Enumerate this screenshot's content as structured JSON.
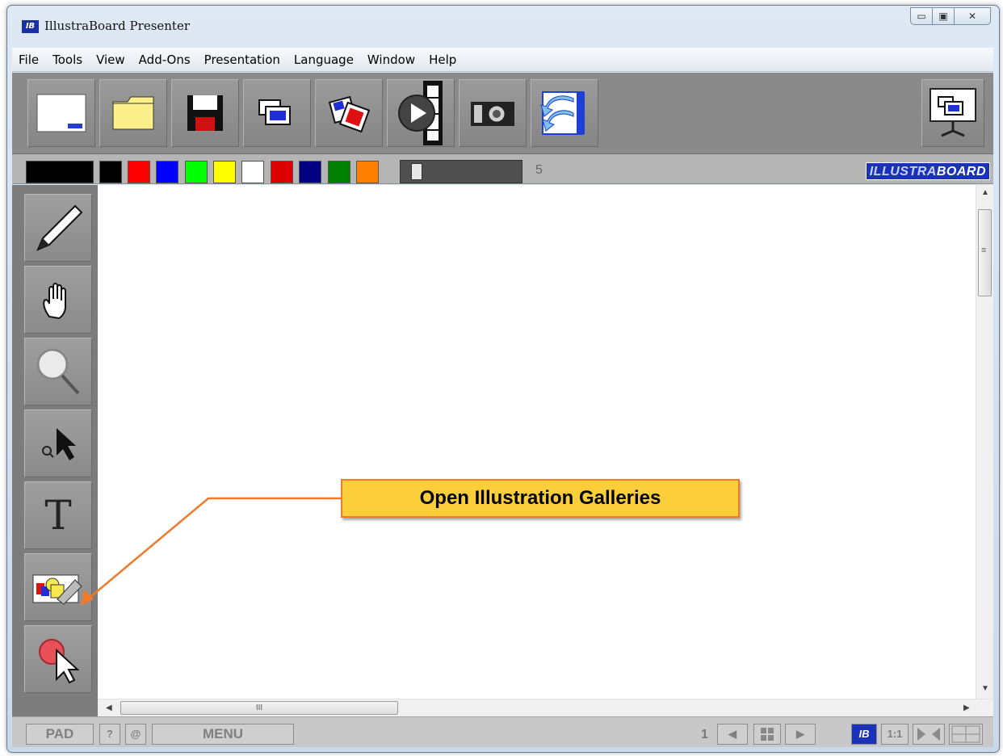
{
  "window": {
    "title": "IllustraBoard Presenter",
    "app_icon_text": "IB",
    "controls": {
      "minimize": "▭",
      "maximize": "▣",
      "close": "✕"
    }
  },
  "menu": {
    "items": [
      "File",
      "Tools",
      "View",
      "Add-Ons",
      "Presentation",
      "Language",
      "Window",
      "Help"
    ]
  },
  "toolbar": {
    "buttons": [
      {
        "name": "new-board-icon"
      },
      {
        "name": "open-folder-icon"
      },
      {
        "name": "save-disk-icon"
      },
      {
        "name": "slides-icon"
      },
      {
        "name": "pictures-icon"
      },
      {
        "name": "video-play-icon"
      },
      {
        "name": "camera-icon"
      },
      {
        "name": "undo-board-icon"
      }
    ],
    "presentation_monitor_icon": "presentation-monitor-icon"
  },
  "colorbar": {
    "current_color": "#000000",
    "swatches": [
      "#000000",
      "#ff0000",
      "#0000ff",
      "#00ff00",
      "#ffff00",
      "#ffffff",
      "#dd0000",
      "#000080",
      "#008000",
      "#ff8000"
    ],
    "thickness_value": "5",
    "logo": {
      "part1": "ILLUSTRA",
      "part2": "BOARD"
    }
  },
  "sidebar": {
    "tools": [
      {
        "name": "pen-tool-icon"
      },
      {
        "name": "hand-tool-icon"
      },
      {
        "name": "zoom-tool-icon"
      },
      {
        "name": "select-pointer-icon"
      },
      {
        "name": "text-tool-icon",
        "label": "T"
      },
      {
        "name": "illustration-gallery-icon"
      },
      {
        "name": "laser-pointer-icon"
      }
    ]
  },
  "scroll": {
    "h_thumb_grip": "III",
    "v_thumb_grip": "≡"
  },
  "statusbar": {
    "pad": "PAD",
    "help": "?",
    "at": "@",
    "menu": "MENU",
    "page": "1",
    "prev": "◀",
    "next": "▶",
    "ib": "IB",
    "one_to_one": "1:1"
  },
  "callout": {
    "text": "Open Illustration Galleries",
    "fill": "#fccf3a",
    "border": "#f07a2a"
  }
}
